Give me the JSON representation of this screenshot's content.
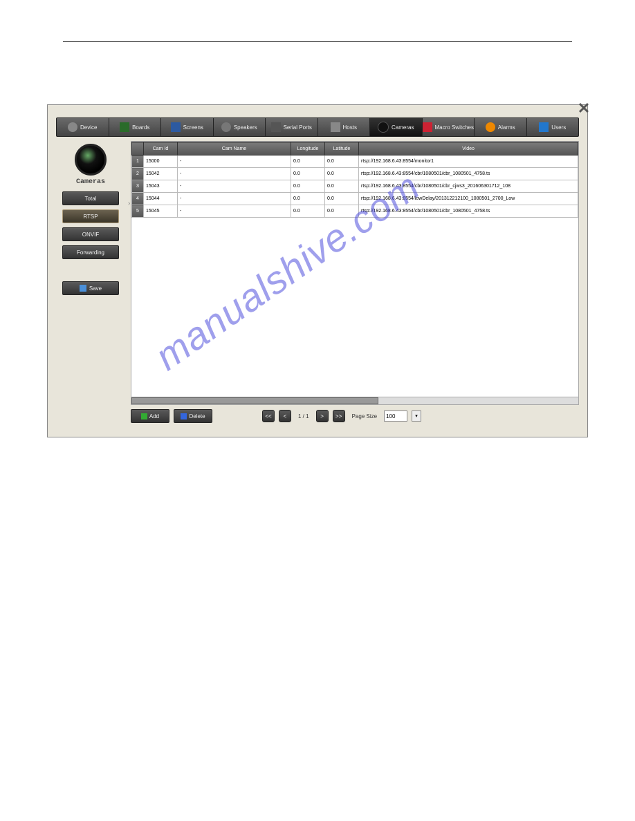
{
  "watermark": "manualshive.com",
  "toolbar": [
    {
      "icon": "ic-device",
      "label": "Device"
    },
    {
      "icon": "ic-boards",
      "label": "Boards"
    },
    {
      "icon": "ic-screens",
      "label": "Screens"
    },
    {
      "icon": "ic-speakers",
      "label": "Speakers"
    },
    {
      "icon": "ic-serial",
      "label": "Serial Ports"
    },
    {
      "icon": "ic-hosts",
      "label": "Hosts"
    },
    {
      "icon": "ic-cameras",
      "label": "Cameras",
      "active": true
    },
    {
      "icon": "ic-macro",
      "label": "Macro Switches"
    },
    {
      "icon": "ic-alarms",
      "label": "Alarms"
    },
    {
      "icon": "ic-users",
      "label": "Users"
    }
  ],
  "sidebar": {
    "title": "Cameras",
    "buttons": [
      "Total",
      "RTSP",
      "ONVIF",
      "Forwarding"
    ],
    "selected": 1,
    "save": "Save"
  },
  "table": {
    "headers": [
      "Cam Id",
      "Cam Name",
      "Longitude",
      "Latitude",
      "Video"
    ],
    "rows": [
      {
        "id": "15000",
        "name": "-",
        "lon": "0.0",
        "lat": "0.0",
        "video": "rtsp://192.168.6.43:8554/monitor1"
      },
      {
        "id": "15042",
        "name": "-",
        "lon": "0.0",
        "lat": "0.0",
        "video": "rtsp://192.168.6.43:8554/cbr/1080501/cbr_1080501_4758.ts"
      },
      {
        "id": "15043",
        "name": "-",
        "lon": "0.0",
        "lat": "0.0",
        "video": "rtsp://192.168.6.43:8554/cbr/1080501/cbr_cjws3_201606301712_108"
      },
      {
        "id": "15044",
        "name": "-",
        "lon": "0.0",
        "lat": "0.0",
        "video": "rtsp://192.168.6.43:8554/lowDelay/201312212100_1080501_2700_Low"
      },
      {
        "id": "15045",
        "name": "-",
        "lon": "0.0",
        "lat": "0.0",
        "video": "rtsp://192.168.6.43:8554/cbr/1080501/cbr_1080501_4758.ts"
      }
    ]
  },
  "actions": {
    "add": "Add",
    "delete": "Delete"
  },
  "pager": {
    "first": "<<",
    "prev": "<",
    "page": "1 / 1",
    "next": ">",
    "last": ">>",
    "page_size_label": "Page Size",
    "page_size": "100"
  }
}
